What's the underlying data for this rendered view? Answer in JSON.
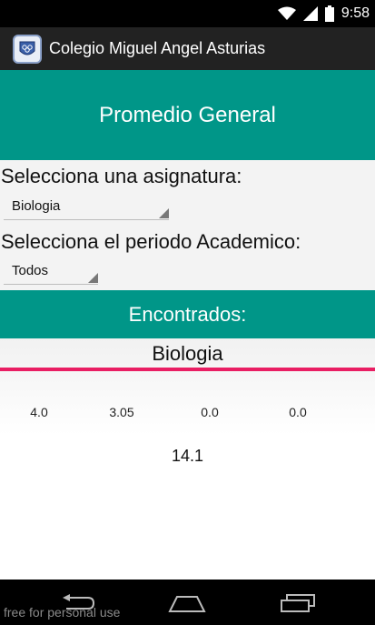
{
  "status_bar": {
    "time": "9:58",
    "icons": [
      "wifi-icon",
      "signal-icon",
      "battery-icon"
    ]
  },
  "action_bar": {
    "title": "Colegio Miguel Angel Asturias",
    "icon": "school-logo-icon"
  },
  "header": {
    "title": "Promedio General"
  },
  "form": {
    "subject_label": "Selecciona una asignatura:",
    "subject_value": "Biologia",
    "period_label": "Selecciona el periodo Academico:",
    "period_value": "Todos"
  },
  "results": {
    "heading": "Encontrados:",
    "subject": "Biologia",
    "grades": [
      "4.0",
      "3.05",
      "0.0",
      "0.0"
    ],
    "total": "14.1"
  },
  "nav_bar": {
    "buttons": [
      "back-icon",
      "home-icon",
      "recents-icon"
    ]
  },
  "watermark": "free for personal use",
  "colors": {
    "primary": "#009688",
    "accent": "#e91e63",
    "action_bar": "#222222"
  }
}
